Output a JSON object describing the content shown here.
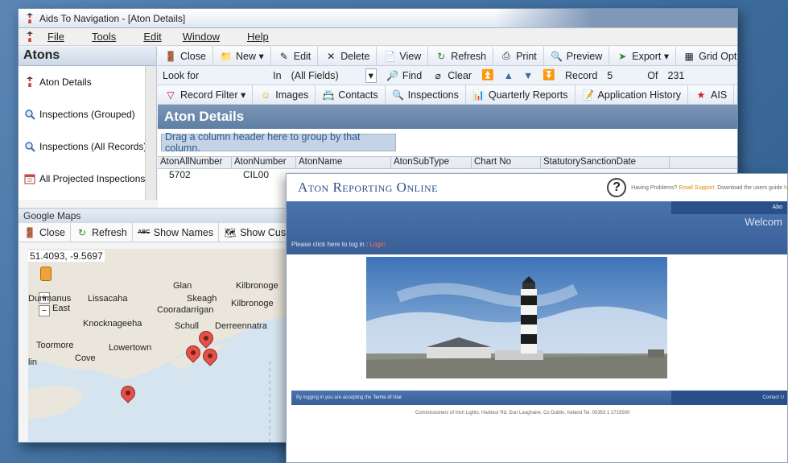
{
  "win1": {
    "title": "Aids To Navigation - [Aton Details]",
    "title_right": "",
    "menu": [
      "File",
      "Tools",
      "Edit",
      "Window",
      "Help"
    ],
    "sidebar": {
      "heading": "Atons",
      "items": [
        {
          "label": "Aton Details",
          "icon": "lighthouse-icon"
        },
        {
          "label": "Inspections (Grouped)",
          "icon": "magnifier-icon"
        },
        {
          "label": "Inspections (All Records)",
          "icon": "magnifier-icon"
        },
        {
          "label": "All Projected Inspections",
          "icon": "calendar-icon"
        }
      ]
    },
    "toolbar1": [
      "Close",
      "New",
      "Edit",
      "Delete",
      "View",
      "Refresh",
      "Print",
      "Preview",
      "Export",
      "Grid Option"
    ],
    "findbar": {
      "look_for": "Look for",
      "in": "In",
      "in_value": "(All Fields)",
      "find": "Find",
      "clear": "Clear",
      "record_label": "Record",
      "record_value": "5",
      "of_label": "Of",
      "of_value": "231"
    },
    "toolbar2": [
      "Record Filter",
      "Images",
      "Contacts",
      "Inspections",
      "Quarterly Reports",
      "Application History",
      "AIS"
    ],
    "panel_title": "Aton Details",
    "group_hint": "Drag a column header here to group by that column.",
    "grid": {
      "columns": [
        "AtonAllNumber",
        "AtonNumber",
        "AtonName",
        "AtonSubType",
        "Chart No",
        "StatutorySanctionDate"
      ],
      "rows": [
        [
          "5702",
          "CIL00"
        ]
      ]
    },
    "gmaps": {
      "title": "Google Maps",
      "tools": [
        "Close",
        "Refresh",
        "Show Names",
        "Show Custo"
      ],
      "coords": "51.4093, -9.5697",
      "places": [
        "Glan",
        "Kilbronoge",
        "Dunmanus",
        "Lissacaha",
        "East",
        "Skeagh",
        "Cooradarrigan",
        "Kilbronoge",
        "Knocknageeha",
        "Schull",
        "Derreennatra",
        "Toormore",
        "Lowertown",
        "Cove",
        "lin"
      ]
    }
  },
  "win2": {
    "logo": "Aton Reporting Online",
    "help_text": "Having Problems?",
    "help_link": "Email Support.",
    "help_text2": "Download the users guide",
    "help_link2": "h",
    "about": "Abo",
    "welcome": "Welcom",
    "login_prompt": "Please click here to log in :",
    "login_link": "Login",
    "foot_text": "By logging in you are accepting the",
    "foot_link": "Terms of Use",
    "contact": "Contact U",
    "address": "Commissioners of Irish Lights, Harbour Rd, Dun Laoghaire, Co Dublin, Ireland Tel. 00353 1 2715500"
  }
}
